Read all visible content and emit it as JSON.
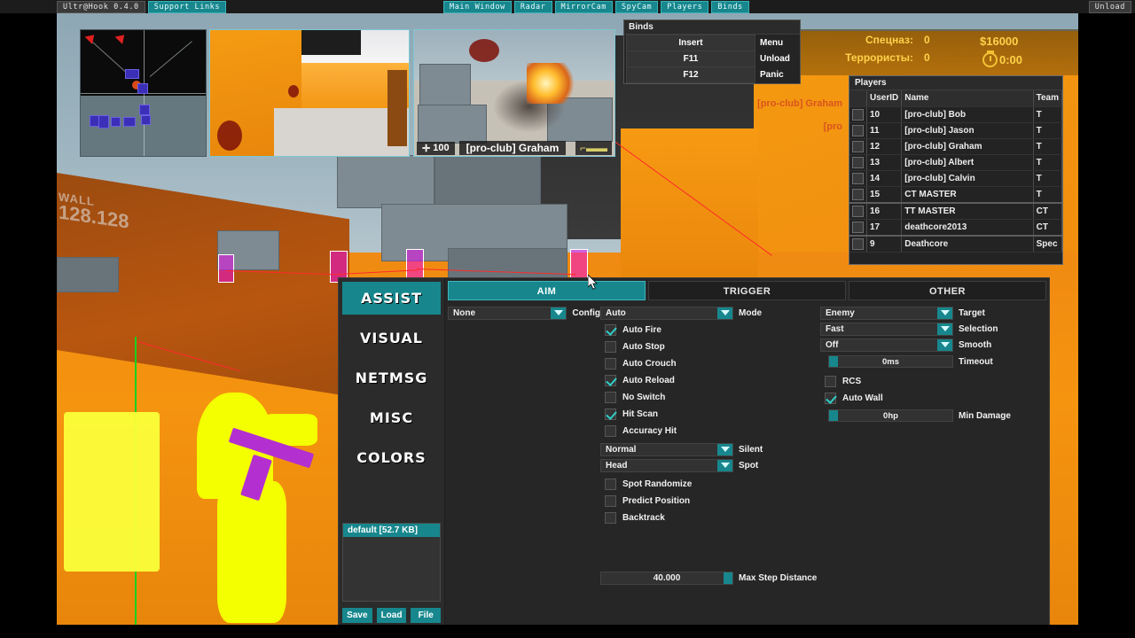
{
  "topbar": {
    "title": "Ultr@Hook 0.4.0",
    "support_label": "Support Links",
    "center_buttons": [
      "Main Window",
      "Radar",
      "MirrorCam",
      "SpyCam",
      "Players",
      "Binds"
    ],
    "unload_label": "Unload"
  },
  "binds_window": {
    "title": "Binds",
    "rows": [
      {
        "key": "Insert",
        "action": "Menu"
      },
      {
        "key": "F11",
        "action": "Unload"
      },
      {
        "key": "F12",
        "action": "Panic"
      }
    ]
  },
  "score_hud": {
    "ct_label": "Спецназ:",
    "ct_score": "0",
    "t_label": "Террористы:",
    "t_score": "0",
    "money": "$16000",
    "time": "0:00"
  },
  "killfeed": [
    "[pro-club] Graham",
    "[pro"
  ],
  "spectator_hud": {
    "health": "100",
    "player_name": "[pro-club] Graham",
    "weapon_icon": "rifle-icon"
  },
  "wall_texture": {
    "line1": "WALL",
    "line2": "128.128"
  },
  "players_window": {
    "title": "Players",
    "columns": [
      "",
      "UserID",
      "Name",
      "Team"
    ],
    "rows": [
      {
        "uid": "10",
        "name": "[pro-club] Bob",
        "team": "T",
        "break": false
      },
      {
        "uid": "11",
        "name": "[pro-club] Jason",
        "team": "T",
        "break": false
      },
      {
        "uid": "12",
        "name": "[pro-club] Graham",
        "team": "T",
        "break": false
      },
      {
        "uid": "13",
        "name": "[pro-club] Albert",
        "team": "T",
        "break": false
      },
      {
        "uid": "14",
        "name": "[pro-club] Calvin",
        "team": "T",
        "break": false
      },
      {
        "uid": "15",
        "name": "CT MASTER",
        "team": "T",
        "break": false
      },
      {
        "uid": "16",
        "name": "TT MASTER",
        "team": "CT",
        "break": true
      },
      {
        "uid": "17",
        "name": "deathcore2013",
        "team": "CT",
        "break": false
      },
      {
        "uid": "9",
        "name": "Deathcore",
        "team": "Spec",
        "break": true
      }
    ]
  },
  "cheat_window": {
    "sidebar": [
      {
        "label": "ASSIST",
        "active": true
      },
      {
        "label": "VISUAL",
        "active": false
      },
      {
        "label": "NETMSG",
        "active": false
      },
      {
        "label": "MISC",
        "active": false
      },
      {
        "label": "COLORS",
        "active": false
      }
    ],
    "config_list": [
      "default [52.7 KB]"
    ],
    "config_buttons": [
      "Save",
      "Load",
      "File"
    ],
    "tabs": [
      {
        "label": "AIM",
        "active": true
      },
      {
        "label": "TRIGGER",
        "active": false
      },
      {
        "label": "OTHER",
        "active": false
      }
    ],
    "column_left": [
      {
        "type": "dropdown",
        "value": "None",
        "label": "Config"
      }
    ],
    "column_middle": [
      {
        "type": "dropdown",
        "value": "Auto",
        "label": "Mode"
      },
      {
        "type": "checkbox",
        "label": "Auto Fire",
        "checked": true
      },
      {
        "type": "checkbox",
        "label": "Auto Stop",
        "checked": false
      },
      {
        "type": "checkbox",
        "label": "Auto Crouch",
        "checked": false
      },
      {
        "type": "checkbox",
        "label": "Auto Reload",
        "checked": true
      },
      {
        "type": "checkbox",
        "label": "No Switch",
        "checked": false
      },
      {
        "type": "checkbox",
        "label": "Hit Scan",
        "checked": true
      },
      {
        "type": "checkbox",
        "label": "Accuracy Hit",
        "checked": false
      },
      {
        "type": "dropdown",
        "value": "Normal",
        "label": "Silent"
      },
      {
        "type": "dropdown",
        "value": "Head",
        "label": "Spot"
      },
      {
        "type": "checkbox",
        "label": "Spot Randomize",
        "checked": false
      },
      {
        "type": "checkbox",
        "label": "Predict Position",
        "checked": false
      },
      {
        "type": "checkbox",
        "label": "Backtrack",
        "checked": false
      }
    ],
    "max_step_distance": {
      "value": "40.000",
      "label": "Max Step Distance"
    },
    "column_right": [
      {
        "type": "dropdown",
        "value": "Enemy",
        "label": "Target"
      },
      {
        "type": "dropdown",
        "value": "Fast",
        "label": "Selection"
      },
      {
        "type": "dropdown",
        "value": "Off",
        "label": "Smooth"
      },
      {
        "type": "slider",
        "value": "0ms",
        "label": "Timeout",
        "fill_pct": 7
      },
      {
        "type": "checkbox",
        "label": "RCS",
        "checked": false
      },
      {
        "type": "checkbox",
        "label": "Auto Wall",
        "checked": true
      },
      {
        "type": "slider",
        "value": "0hp",
        "label": "Min Damage",
        "fill_pct": 7
      }
    ]
  },
  "colors": {
    "accent_teal": "#17878d",
    "panel_bg": "#262626",
    "sidebar_bg": "#2b2b2b",
    "check_green": "#2fd0c8",
    "hud_gold": "#ffd24a",
    "killfeed_orange": "#d9541f",
    "chams_yellow": "#f4ff00",
    "chams_purple": "#b42fd0"
  }
}
